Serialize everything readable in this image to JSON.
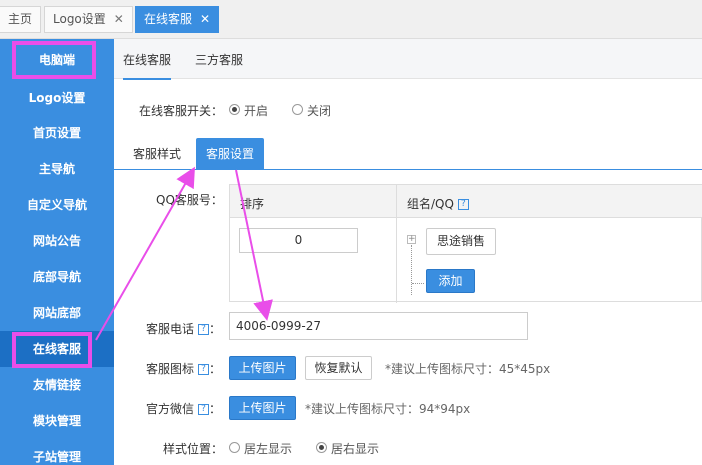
{
  "top_tabs": [
    {
      "label": "主页",
      "closable": false,
      "active": false
    },
    {
      "label": "Logo设置",
      "closable": true,
      "active": false
    },
    {
      "label": "在线客服",
      "closable": true,
      "active": true
    }
  ],
  "close_glyph": "✕",
  "sidebar": {
    "items": [
      {
        "label": "电脑端"
      },
      {
        "label": "Logo设置"
      },
      {
        "label": "首页设置"
      },
      {
        "label": "主导航"
      },
      {
        "label": "自定义导航"
      },
      {
        "label": "网站公告"
      },
      {
        "label": "底部导航"
      },
      {
        "label": "网站底部"
      },
      {
        "label": "在线客服"
      },
      {
        "label": "友情链接"
      },
      {
        "label": "模块管理"
      },
      {
        "label": "子站管理"
      }
    ]
  },
  "sub_tabs": [
    {
      "label": "在线客服"
    },
    {
      "label": "三方客服"
    }
  ],
  "switch": {
    "label": "在线客服开关：",
    "options": [
      {
        "label": "开启",
        "checked": true
      },
      {
        "label": "关闭",
        "checked": false
      }
    ]
  },
  "inner_tabs": [
    {
      "label": "客服样式"
    },
    {
      "label": "客服设置"
    }
  ],
  "qq": {
    "label": "QQ客服号：",
    "col_sort": "排序",
    "col_group": "组名/QQ",
    "help": "?",
    "sort_value": "0",
    "group_name": "思途销售",
    "add_label": "添加",
    "plus_glyph": "+"
  },
  "phone": {
    "label": "客服电话",
    "help": "?",
    "value": "4006-0999-27"
  },
  "icon_row": {
    "label": "客服图标",
    "help": "?",
    "upload_label": "上传图片",
    "reset_label": "恢复默认",
    "hint": "*建议上传图标尺寸：45*45px"
  },
  "wechat_row": {
    "label": "官方微信",
    "help": "?",
    "upload_label": "上传图片",
    "hint": "*建议上传图标尺寸：94*94px"
  },
  "position": {
    "label": "样式位置：",
    "options": [
      {
        "label": "居左显示",
        "checked": false
      },
      {
        "label": "居右显示",
        "checked": true
      }
    ]
  },
  "colors": {
    "accent": "#3a8ee0",
    "sidebar_active": "#1c6fc4",
    "annotation": "#e94ee9"
  }
}
